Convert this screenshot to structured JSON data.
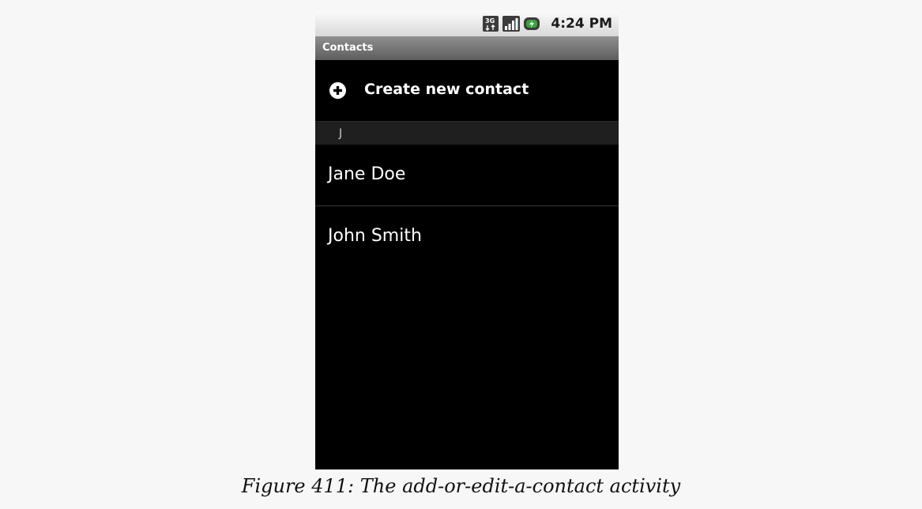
{
  "status_bar": {
    "time": "4:24 PM",
    "icons": [
      "3g-data-icon",
      "signal-strength-icon",
      "battery-charging-icon"
    ]
  },
  "title_bar": {
    "title": "Contacts"
  },
  "create_row": {
    "icon": "add-circle-icon",
    "label": "Create new contact"
  },
  "section": {
    "letter": "J"
  },
  "contacts": [
    {
      "name": "Jane Doe"
    },
    {
      "name": "John Smith"
    }
  ],
  "caption": "Figure 411: The add-or-edit-a-contact activity",
  "colors": {
    "screen_background": "#000000",
    "page_background": "#f7f7f7",
    "status_bar_top": "#fbfbfb",
    "status_bar_bottom": "#d8d8d8",
    "title_bar_top": "#8f8f8f",
    "title_bar_bottom": "#5e5e5e",
    "section_header": "#1f1f1f",
    "battery_green": "#3aa33a"
  }
}
